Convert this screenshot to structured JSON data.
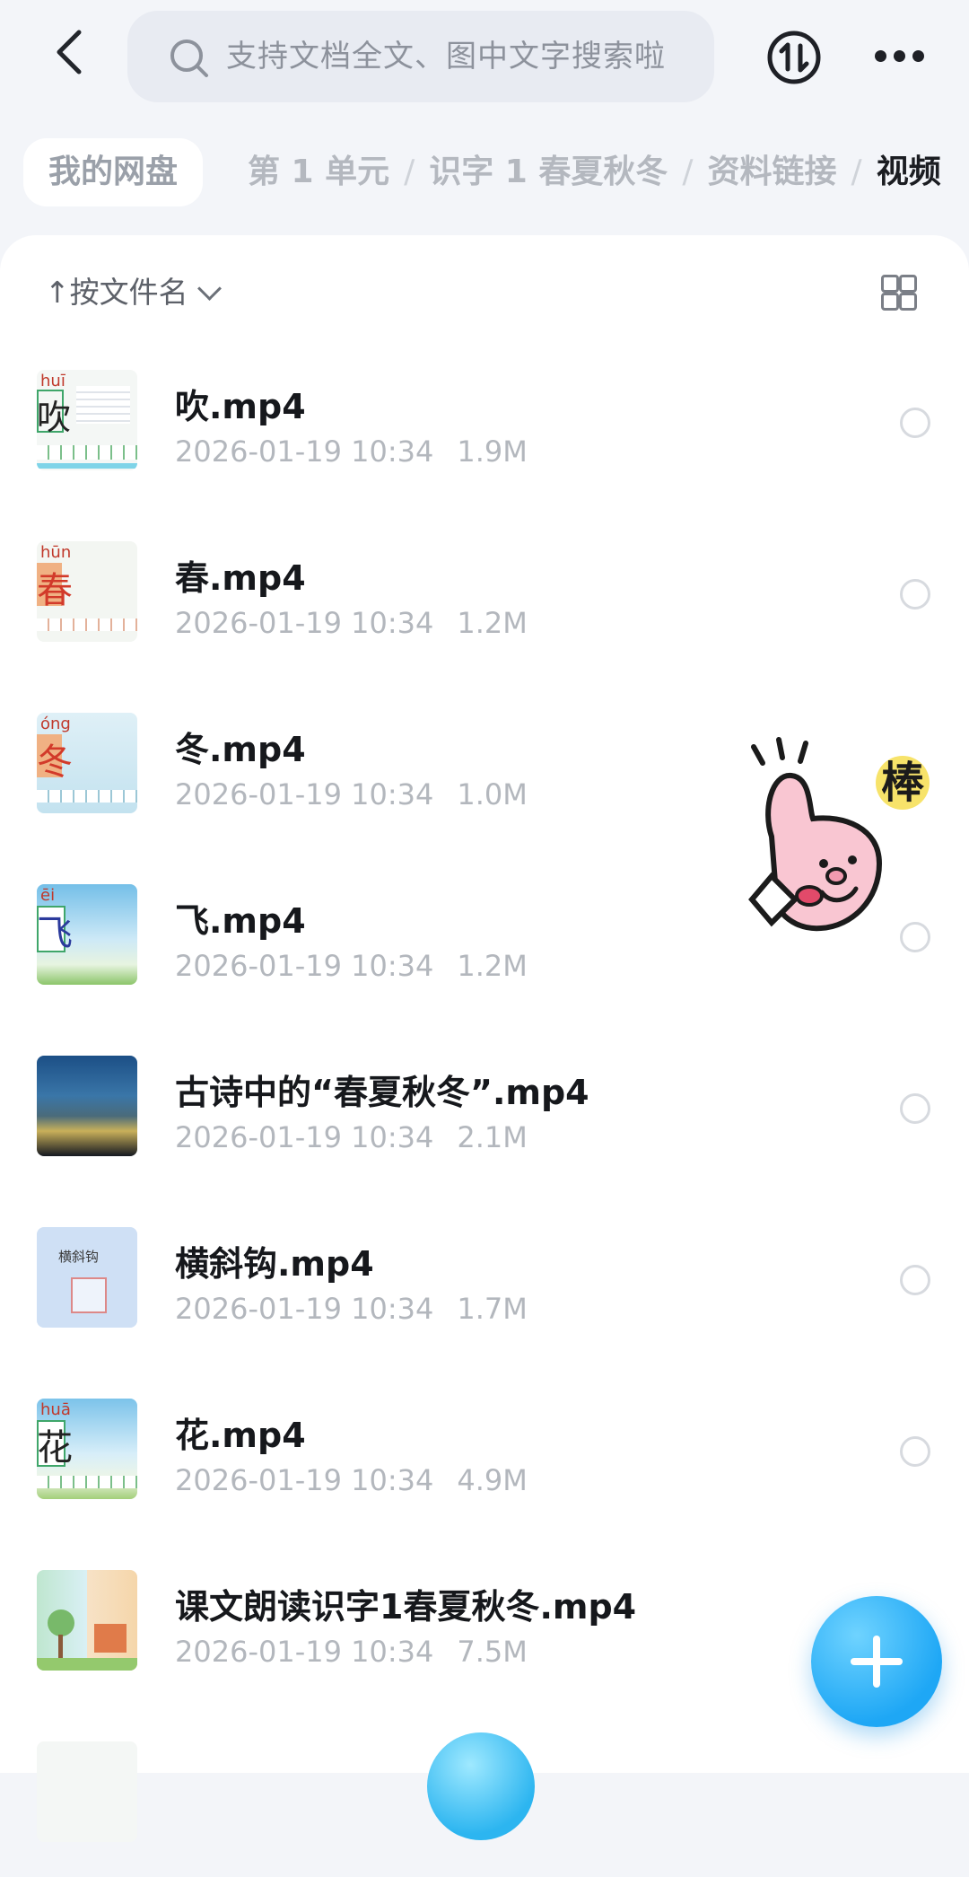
{
  "search": {
    "placeholder": "支持文档全文、图中文字搜索啦"
  },
  "breadcrumb": {
    "home": "我的网盘",
    "trail": [
      "第 1 单元",
      "识字 1 春夏秋冬",
      "资料链接"
    ],
    "current": "视频"
  },
  "sort": {
    "label": "按文件名",
    "arrow": "↑"
  },
  "files": [
    {
      "name": "吹.mp4",
      "date": "2026-01-19 10:34",
      "size": "1.9M"
    },
    {
      "name": "春.mp4",
      "date": "2026-01-19 10:34",
      "size": "1.2M"
    },
    {
      "name": "冬.mp4",
      "date": "2026-01-19 10:34",
      "size": "1.0M"
    },
    {
      "name": "飞.mp4",
      "date": "2026-01-19 10:34",
      "size": "1.2M"
    },
    {
      "name": "古诗中的“春夏秋冬”.mp4",
      "date": "2026-01-19 10:34",
      "size": "2.1M"
    },
    {
      "name": "横斜钩.mp4",
      "date": "2026-01-19 10:34",
      "size": "1.7M"
    },
    {
      "name": "花.mp4",
      "date": "2026-01-19 10:34",
      "size": "4.9M"
    },
    {
      "name": "课文朗读识字1春夏秋冬.mp4",
      "date": "2026-01-19 10:34",
      "size": "7.5M"
    }
  ],
  "thumbs": {
    "chars": [
      "吹",
      "春",
      "冬",
      "飞",
      "",
      "横斜钩",
      "花",
      ""
    ],
    "pinyin": [
      "huī",
      "hūn",
      "óng",
      "ēi",
      "",
      "",
      "huā",
      ""
    ]
  },
  "sticker": {
    "text": "棒"
  },
  "icons": {
    "back": "chevron-left-icon",
    "search": "search-icon",
    "sync": "transfer-icon",
    "more": "more-icon",
    "grid": "grid-view-icon",
    "fab": "plus-icon"
  },
  "colors": {
    "accent": "#1ea7f5",
    "background": "#f3f5f9"
  }
}
